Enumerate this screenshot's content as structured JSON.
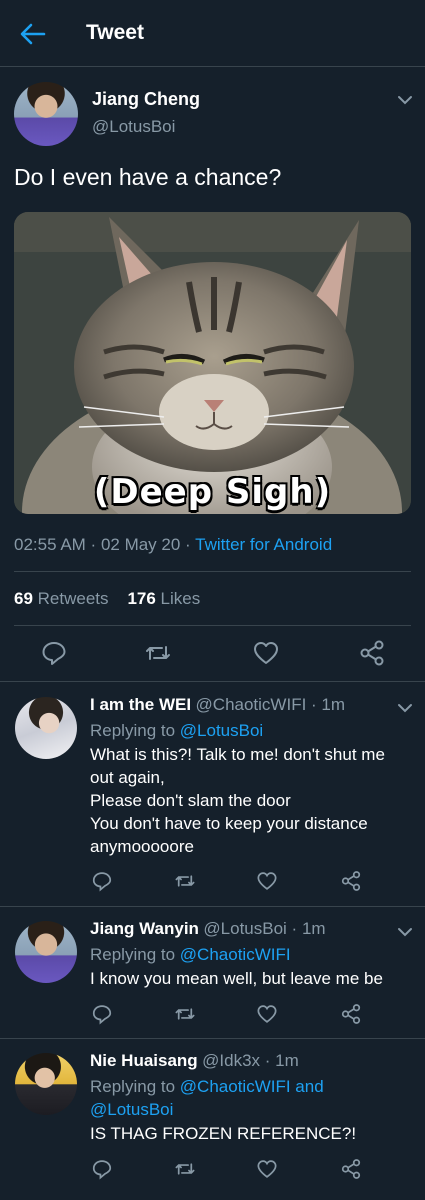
{
  "header": {
    "title": "Tweet"
  },
  "tweet": {
    "name": "Jiang Cheng",
    "handle": "@LotusBoi",
    "text": "Do I even have a chance?",
    "image_caption": "(Deep Sigh)",
    "time": "02:55 AM",
    "date": "02 May 20",
    "source": "Twitter for Android",
    "retweets_count": "69",
    "retweets_label": "Retweets",
    "likes_count": "176",
    "likes_label": "Likes"
  },
  "replies": [
    {
      "name": "I am the WEI",
      "handle": "@ChaoticWIFI",
      "time": "1m",
      "replying_label": "Replying to",
      "replying_to": "@LotusBoi",
      "lines": [
        "What is this?! Talk to me! don't shut me",
        "out again,",
        "Please don't slam the door",
        "You don't have to keep your distance",
        "anymooooore"
      ]
    },
    {
      "name": "Jiang Wanyin",
      "handle": "@LotusBoi",
      "time": "1m",
      "replying_label": "Replying to",
      "replying_to": "@ChaoticWIFI",
      "lines": [
        "I know you mean well, but leave me be"
      ]
    },
    {
      "name": "Nie Huaisang",
      "handle": "@Idk3x",
      "time": "1m",
      "replying_label": "Replying to",
      "replying_to": "@ChaoticWIFI and",
      "replying_to_2": "@LotusBoi",
      "lines": [
        "IS THAG FROZEN REFERENCE?!"
      ]
    }
  ],
  "icons": [
    "back-arrow-icon",
    "chevron-down-icon",
    "reply-icon",
    "retweet-icon",
    "like-icon",
    "share-icon"
  ],
  "colors": {
    "background": "#15202b",
    "accent": "#1da1f2",
    "muted": "#8899a6",
    "divider": "#38444d"
  }
}
